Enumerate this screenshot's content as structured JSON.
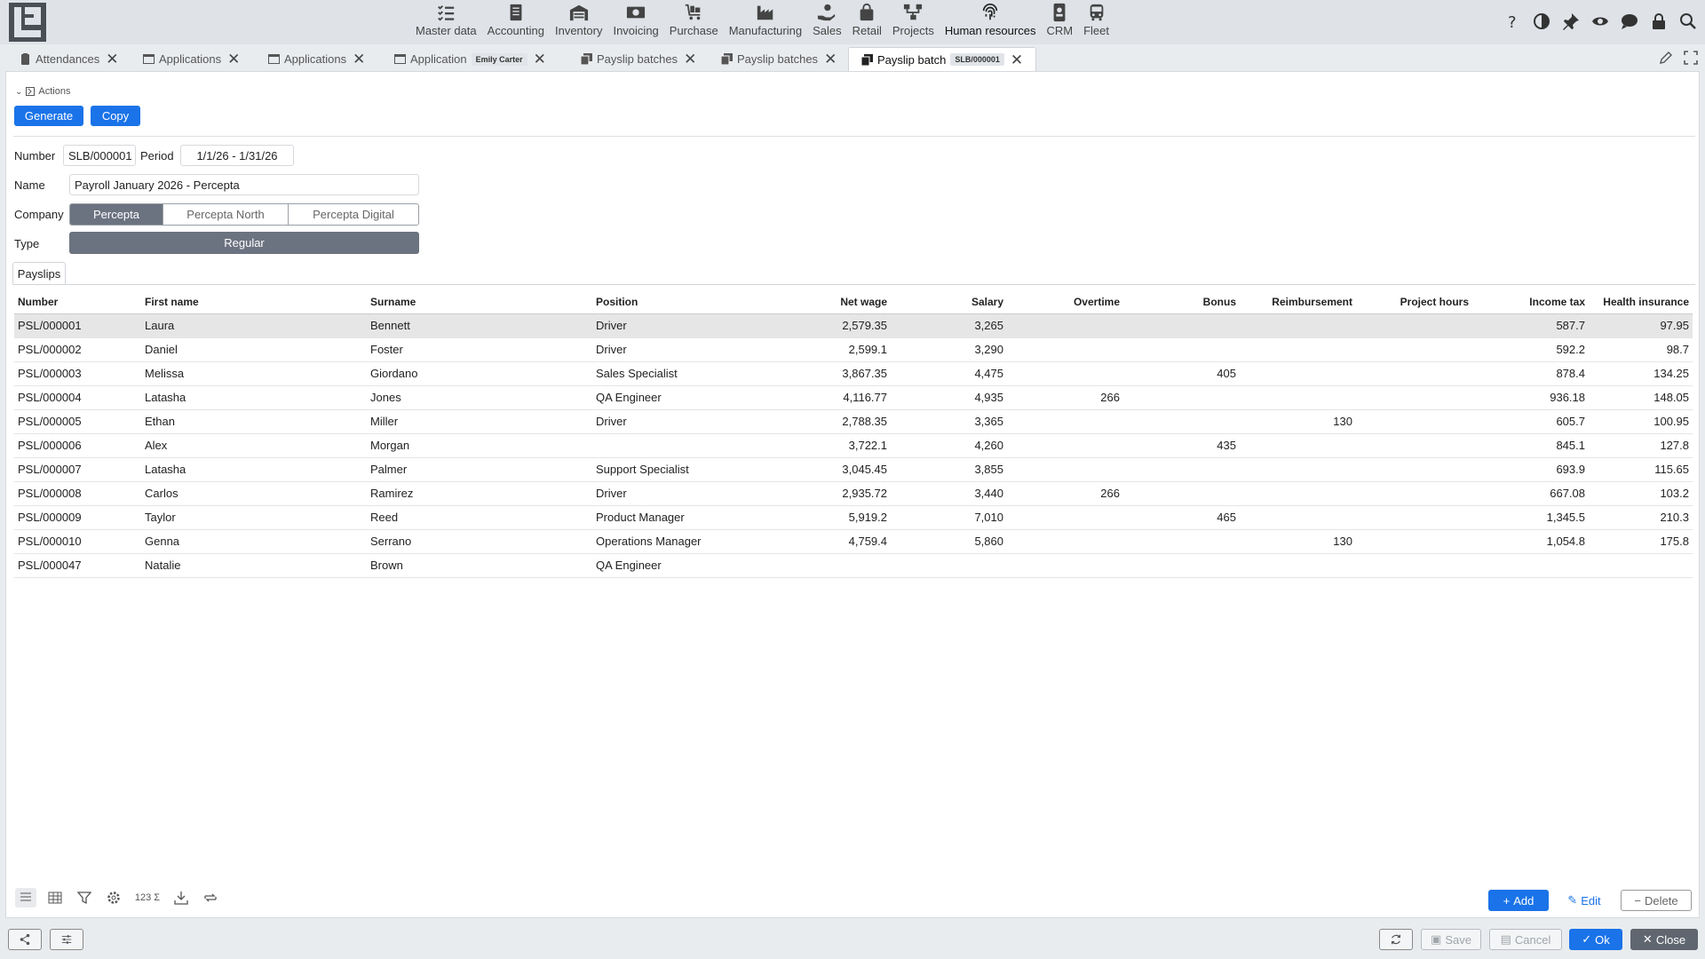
{
  "nav": {
    "modules": [
      {
        "label": "Master data",
        "icon": "list-check-icon"
      },
      {
        "label": "Accounting",
        "icon": "ledger-icon"
      },
      {
        "label": "Inventory",
        "icon": "warehouse-icon"
      },
      {
        "label": "Invoicing",
        "icon": "money-icon"
      },
      {
        "label": "Purchase",
        "icon": "cart-icon"
      },
      {
        "label": "Manufacturing",
        "icon": "factory-icon"
      },
      {
        "label": "Sales",
        "icon": "hand-coin-icon"
      },
      {
        "label": "Retail",
        "icon": "shopping-bag-icon"
      },
      {
        "label": "Projects",
        "icon": "project-tree-icon"
      },
      {
        "label": "Human resources",
        "icon": "fingerprint-icon"
      },
      {
        "label": "CRM",
        "icon": "contact-card-icon"
      },
      {
        "label": "Fleet",
        "icon": "bus-icon"
      }
    ],
    "active_module": "Human resources"
  },
  "tabs": [
    {
      "label": "Attendances",
      "badge": ""
    },
    {
      "label": "Applications",
      "badge": ""
    },
    {
      "label": "Applications",
      "badge": ""
    },
    {
      "label": "Application",
      "badge": "Emily Carter"
    },
    {
      "label": "Payslip batches",
      "badge": ""
    },
    {
      "label": "Payslip batches",
      "badge": ""
    },
    {
      "label": "Payslip batch",
      "badge": "SLB/000001"
    }
  ],
  "actions": {
    "header": "Actions",
    "generate": "Generate",
    "copy": "Copy"
  },
  "form": {
    "number_label": "Number",
    "number_value": "SLB/000001",
    "period_label": "Period",
    "period_value": "1/1/26 - 1/31/26",
    "name_label": "Name",
    "name_value": "Payroll January 2026 - Percepta",
    "company_label": "Company",
    "company_options": [
      "Percepta",
      "Percepta North",
      "Percepta Digital"
    ],
    "company_selected": "Percepta",
    "type_label": "Type",
    "type_value": "Regular"
  },
  "subtab": "Payslips",
  "table": {
    "columns": [
      "Number",
      "First name",
      "Surname",
      "Position",
      "Net wage",
      "Salary",
      "Overtime",
      "Bonus",
      "Reimbursement",
      "Project hours",
      "Income tax",
      "Health insurance"
    ],
    "rows": [
      [
        "PSL/000001",
        "Laura",
        "Bennett",
        "Driver",
        "2,579.35",
        "3,265",
        "",
        "",
        "",
        "",
        "587.7",
        "97.95"
      ],
      [
        "PSL/000002",
        "Daniel",
        "Foster",
        "Driver",
        "2,599.1",
        "3,290",
        "",
        "",
        "",
        "",
        "592.2",
        "98.7"
      ],
      [
        "PSL/000003",
        "Melissa",
        "Giordano",
        "Sales Specialist",
        "3,867.35",
        "4,475",
        "",
        "405",
        "",
        "",
        "878.4",
        "134.25"
      ],
      [
        "PSL/000004",
        "Latasha",
        "Jones",
        "QA Engineer",
        "4,116.77",
        "4,935",
        "266",
        "",
        "",
        "",
        "936.18",
        "148.05"
      ],
      [
        "PSL/000005",
        "Ethan",
        "Miller",
        "Driver",
        "2,788.35",
        "3,365",
        "",
        "",
        "130",
        "",
        "605.7",
        "100.95"
      ],
      [
        "PSL/000006",
        "Alex",
        "Morgan",
        "",
        "3,722.1",
        "4,260",
        "",
        "435",
        "",
        "",
        "845.1",
        "127.8"
      ],
      [
        "PSL/000007",
        "Latasha",
        "Palmer",
        "Support Specialist",
        "3,045.45",
        "3,855",
        "",
        "",
        "",
        "",
        "693.9",
        "115.65"
      ],
      [
        "PSL/000008",
        "Carlos",
        "Ramirez",
        "Driver",
        "2,935.72",
        "3,440",
        "266",
        "",
        "",
        "",
        "667.08",
        "103.2"
      ],
      [
        "PSL/000009",
        "Taylor",
        "Reed",
        "Product Manager",
        "5,919.2",
        "7,010",
        "",
        "465",
        "",
        "",
        "1,345.5",
        "210.3"
      ],
      [
        "PSL/000010",
        "Genna",
        "Serrano",
        "Operations Manager",
        "4,759.4",
        "5,860",
        "",
        "",
        "130",
        "",
        "1,054.8",
        "175.8"
      ],
      [
        "PSL/000047",
        "Natalie",
        "Brown",
        "QA Engineer",
        "",
        "",
        "",
        "",
        "",
        "",
        "",
        ""
      ]
    ]
  },
  "bottom": {
    "sum_label": "123",
    "add": "Add",
    "edit": "Edit",
    "delete": "Delete"
  },
  "footer": {
    "save": "Save",
    "cancel": "Cancel",
    "ok": "Ok",
    "close": "Close"
  },
  "colors": {
    "accent": "#1a73e8",
    "segment_selected": "#6b7280",
    "close_button": "#5f6670"
  }
}
